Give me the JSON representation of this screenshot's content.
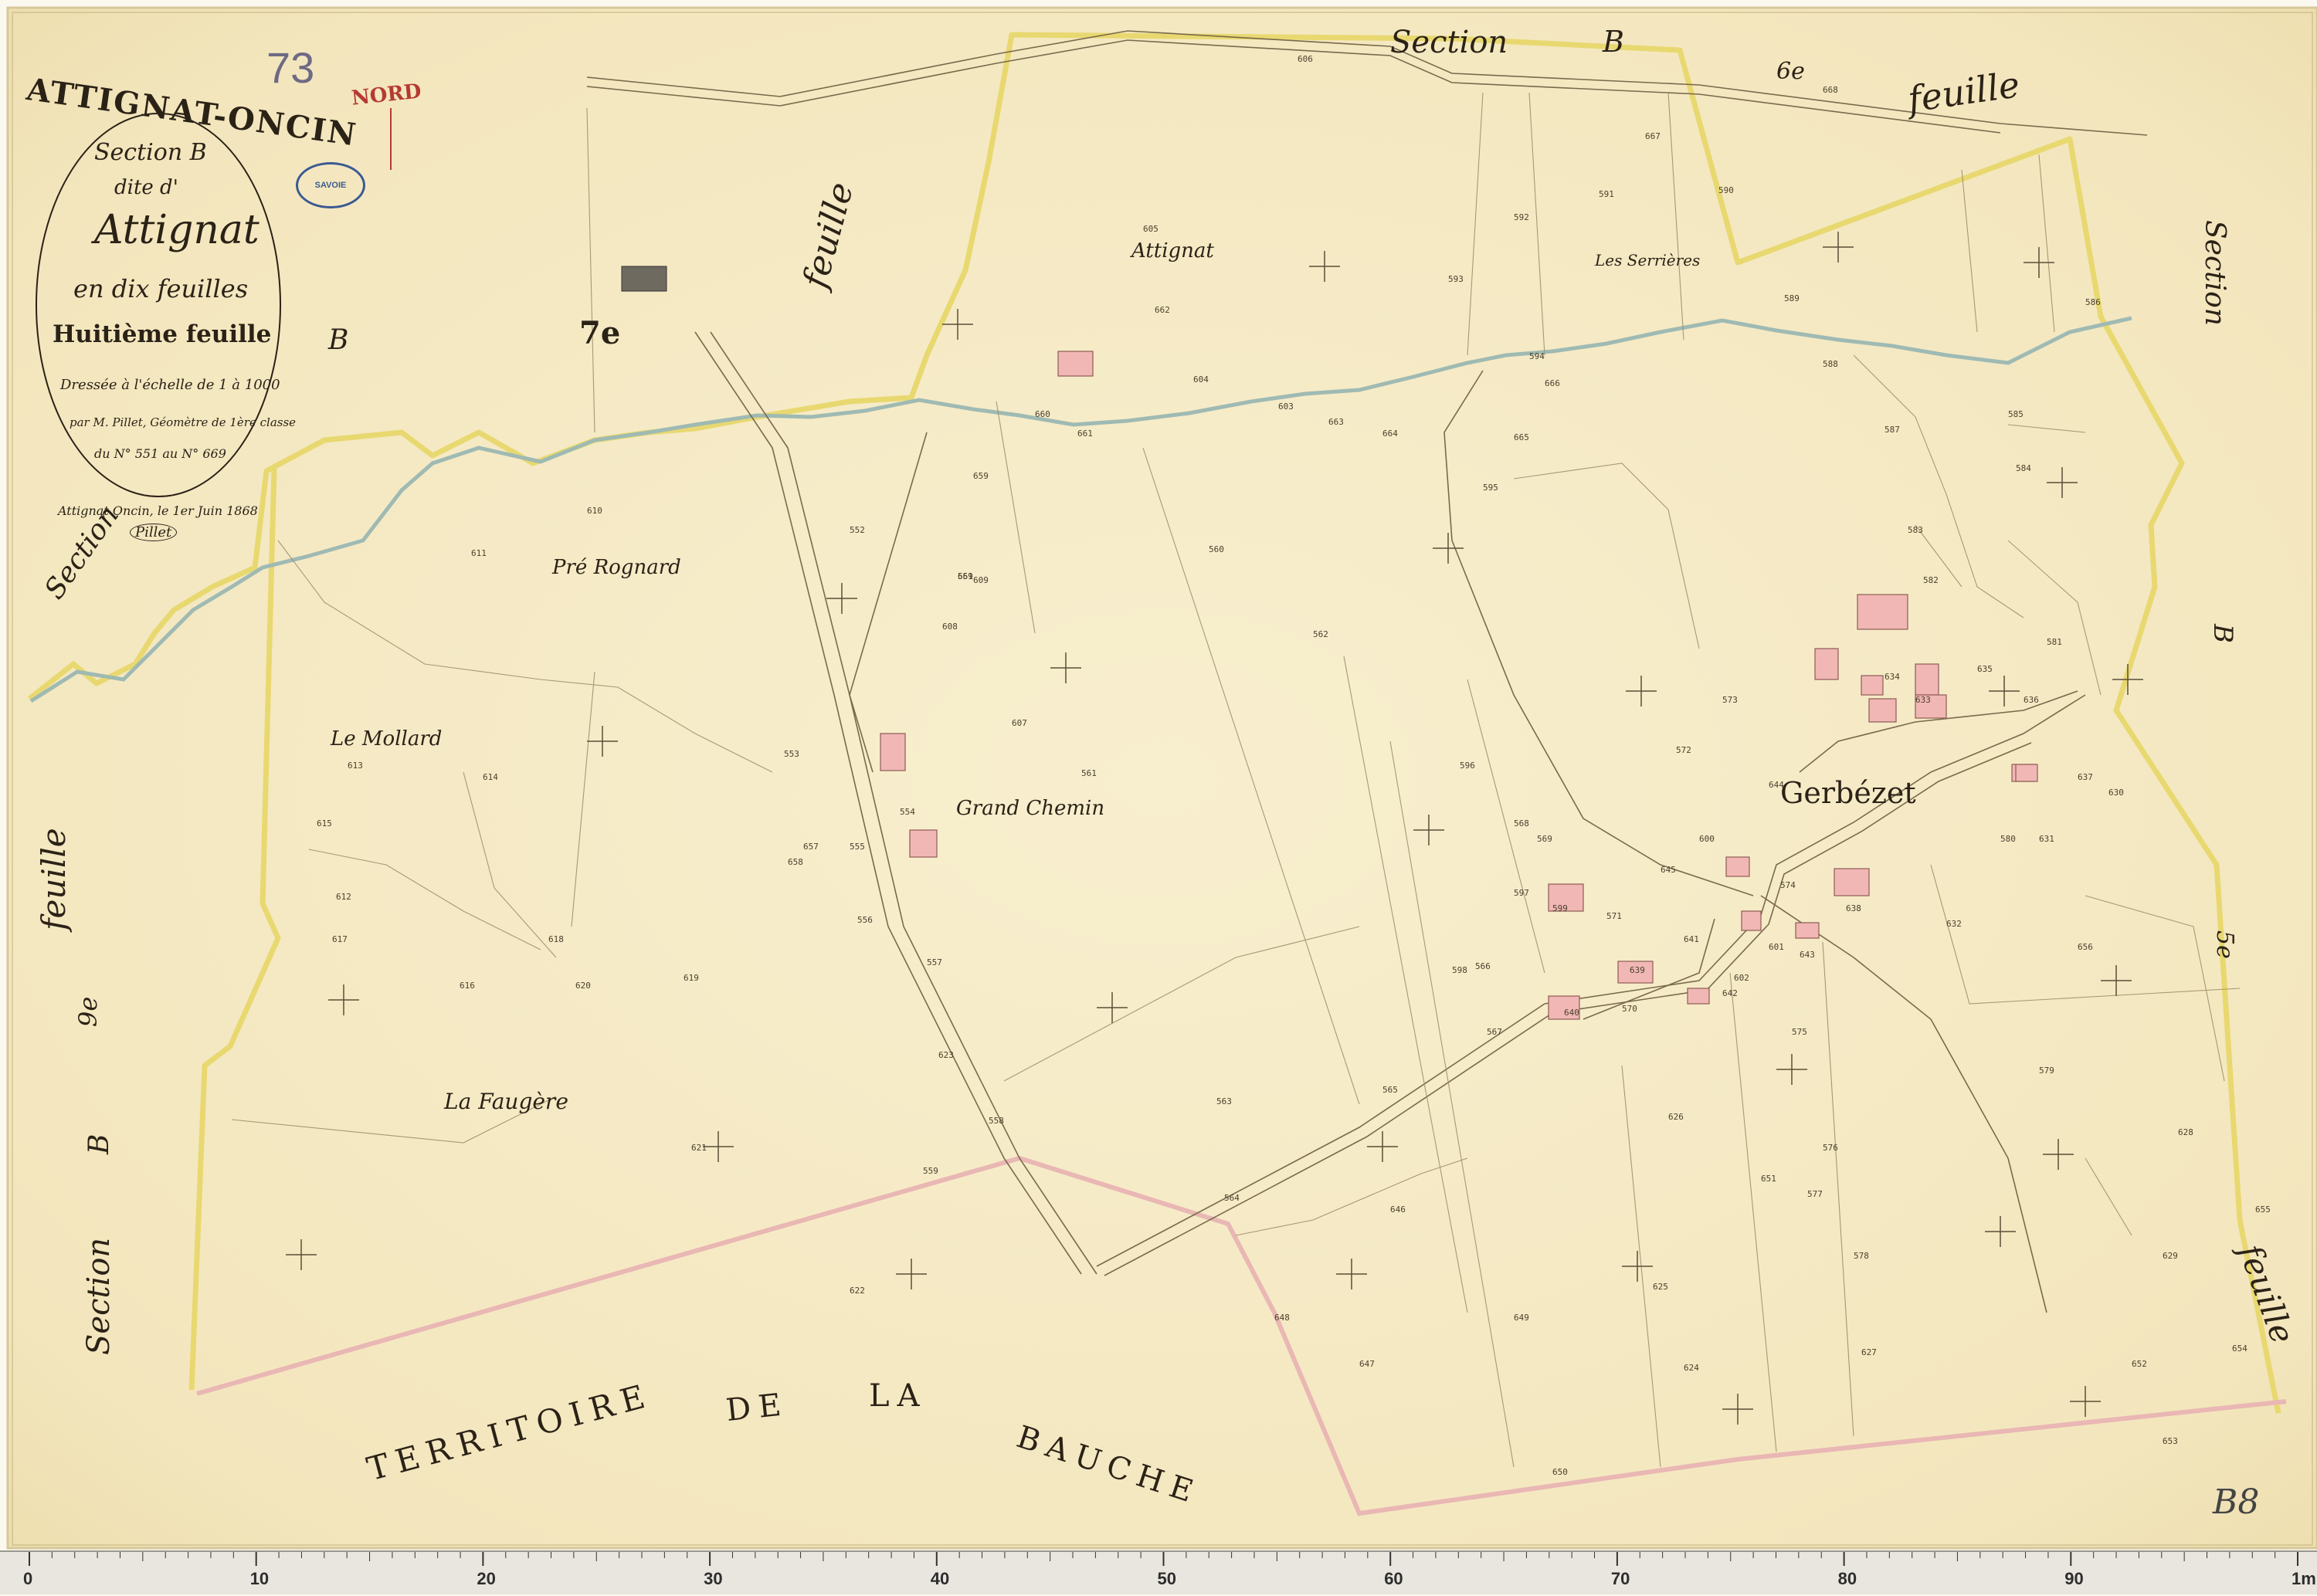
{
  "title": {
    "commune": "ATTIGNAT-ONCIN",
    "archive_number": "73",
    "nord": "NORD",
    "stamp": "SAVOIE",
    "section_line": "Section B",
    "dite_line": "dite d'",
    "place_line": "Attignat",
    "division_line": "en dix feuilles",
    "sheet_line": "Huitième feuille",
    "scale_line": "Dressée à l'échelle de 1 à 1000",
    "surveyor_line": "par M. Pillet, Géomètre de 1ère classe",
    "range_line": "du N° 551 au N° 669",
    "date_line": "Attignat Oncin, le 1er Juin 1868",
    "signature": "Pillet"
  },
  "map": {
    "edge_labels": {
      "top_section": "Section",
      "top_b": "B",
      "top_right_6": "6e",
      "top_right_feuille": "feuille",
      "left_section": "Section",
      "left_b_top": "B",
      "left_feuille": "feuille",
      "left_9": "9e",
      "left_b_bottom": "B",
      "left_section_bottom": "Section",
      "right_section": "Section",
      "right_b": "B",
      "right_5": "5e",
      "right_feuille": "feuille",
      "feuille_7": "7e",
      "feuille_mid": "feuille",
      "sheet_code": "B8"
    },
    "places": {
      "attignat": "Attignat",
      "serrieres": "Les Serrières",
      "pre_rognard": "Pré Rognard",
      "mollard": "Le Mollard",
      "grand_chemin": "Grand Chemin",
      "gerbezet": "Gerbézet",
      "faugere": "La Faugère"
    },
    "territoire": [
      "TERRITOIRE",
      "DE",
      "LA",
      "BAUCHE"
    ],
    "parcels": [
      "551",
      "552",
      "553",
      "554",
      "555",
      "556",
      "557",
      "558",
      "559",
      "560",
      "561",
      "562",
      "563",
      "564",
      "565",
      "566",
      "567",
      "568",
      "569",
      "570",
      "571",
      "572",
      "573",
      "574",
      "575",
      "576",
      "577",
      "578",
      "579",
      "580",
      "581",
      "582",
      "583",
      "584",
      "585",
      "586",
      "587",
      "588",
      "589",
      "590",
      "591",
      "592",
      "593",
      "594",
      "595",
      "596",
      "597",
      "598",
      "599",
      "600",
      "601",
      "602",
      "603",
      "604",
      "605",
      "606",
      "607",
      "608",
      "609",
      "610",
      "611",
      "612",
      "613",
      "614",
      "615",
      "616",
      "617",
      "618",
      "619",
      "620",
      "621",
      "622",
      "623",
      "624",
      "625",
      "626",
      "627",
      "628",
      "629",
      "630",
      "631",
      "632",
      "633",
      "634",
      "635",
      "636",
      "637",
      "638",
      "639",
      "640",
      "641",
      "642",
      "643",
      "644",
      "645",
      "646",
      "647",
      "648",
      "649",
      "650",
      "651",
      "652",
      "653",
      "654",
      "655",
      "656",
      "657",
      "658",
      "659",
      "660",
      "661",
      "662",
      "663",
      "664",
      "665",
      "666",
      "667",
      "668",
      "669"
    ],
    "colors": {
      "paper": "#f6ecc9",
      "commune_boundary": "#e8d870",
      "territory_boundary": "#e9b7b4",
      "river": "#8fb3b0",
      "building": "#f0b7b5",
      "ink": "#2b2217"
    }
  },
  "ruler": {
    "labels": [
      "0",
      "10",
      "20",
      "30",
      "40",
      "50",
      "60",
      "70",
      "80",
      "90",
      "1m"
    ]
  }
}
